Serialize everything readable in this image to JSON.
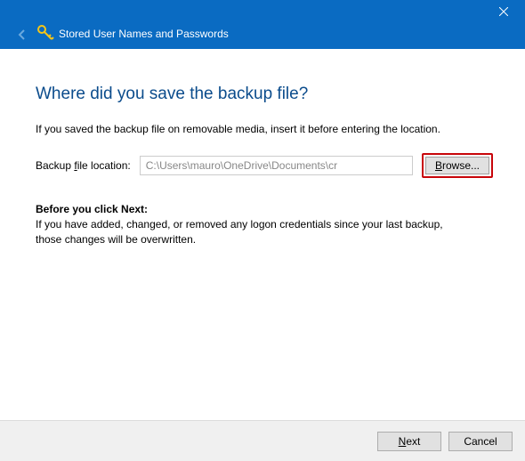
{
  "window": {
    "title": "Stored User Names and Passwords"
  },
  "page": {
    "heading": "Where did you save the backup file?",
    "intro": "If you saved the backup file on removable media, insert it before entering the location.",
    "field_label_pre": "Backup ",
    "field_label_hotkey": "f",
    "field_label_post": "ile location:",
    "path_value": "C:\\Users\\mauro\\OneDrive\\Documents\\cr",
    "browse_label_hotkey": "B",
    "browse_label_rest": "rowse...",
    "section_head": "Before you click Next:",
    "section_body": "If you have added, changed, or removed any logon credentials since your last backup, those changes will be overwritten."
  },
  "footer": {
    "next_hotkey": "N",
    "next_rest": "ext",
    "cancel": "Cancel"
  }
}
